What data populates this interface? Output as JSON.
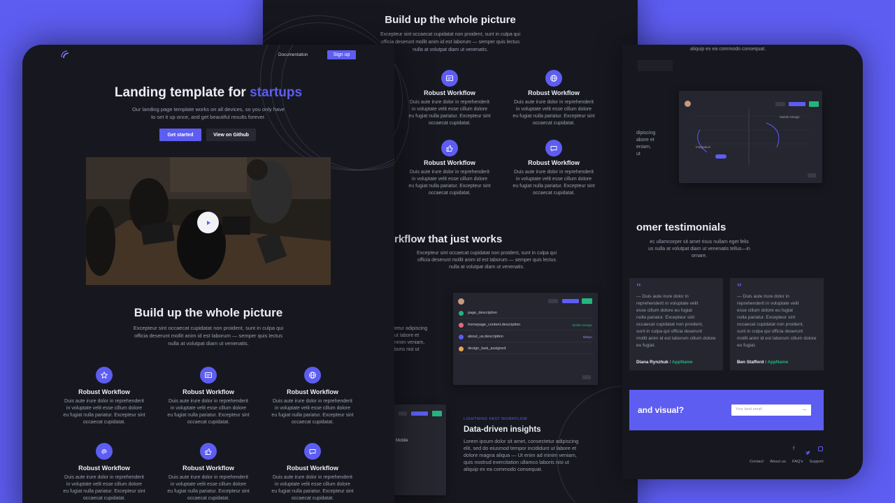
{
  "front": {
    "nav": {
      "documentation": "Documentation",
      "signup": "Sign up"
    },
    "hero": {
      "title_main": "Landing template for ",
      "title_accent": "startups",
      "subtitle_line1": "Our landing page template works on all devices, so you only have",
      "subtitle_line2": "to set it up once, and get beautiful results forever.",
      "get_started": "Get started",
      "github": "View on Github"
    },
    "section": {
      "title": "Build up the whole picture",
      "line1": "Excepteur sint occaecat cupidatat non proident, sunt in culpa qui",
      "line2": "officia deserunt mollit anim id est laborum — semper quis lectus",
      "line3": "nulla at volutpat diam ut venenatis."
    },
    "features": [
      {
        "icon": "star-icon",
        "title": "Robust Workflow"
      },
      {
        "icon": "browser-icon",
        "title": "Robust Workflow"
      },
      {
        "icon": "globe-icon",
        "title": "Robust Workflow"
      },
      {
        "icon": "fingerprint-icon",
        "title": "Robust Workflow"
      },
      {
        "icon": "thumbs-up-icon",
        "title": "Robust Workflow"
      },
      {
        "icon": "chat-icon",
        "title": "Robust Workflow"
      }
    ],
    "feature_text": {
      "l1": "Duis aute irure dolor in reprehenderit",
      "l2": "in voluptate velit esse cillum dolore",
      "l3": "eu fugiat nulla pariatur. Excepteur sint",
      "l4": "occaecat cupidatat."
    }
  },
  "back": {
    "section": {
      "title": "Build up the whole picture",
      "line1": "Excepteur sint occaecat cupidatat non proident, sunt in culpa qui",
      "line2": "officia deserunt mollit anim id est laborum — semper quis lectus",
      "line3": "nulla at volutpat diam ut venenatis."
    },
    "features": [
      {
        "icon": "browser-icon",
        "title": "Robust Workflow"
      },
      {
        "icon": "globe-icon",
        "title": "Robust Workflow"
      },
      {
        "icon": "thumbs-up-icon",
        "title": "Robust Workflow"
      },
      {
        "icon": "chat-icon",
        "title": "Robust Workflow"
      }
    ],
    "workflow": {
      "title": "rkflow that just works",
      "line1": "Excepteur sint occaecat cupidatat non proident, sunt in culpa qui",
      "line2": "officia deserunt mollit anim id est laborum — semper quis lectus",
      "line3": "nulla at volutpat diam ut venenatis.",
      "side_line1": "tetur adipiscing",
      "side_line2": "ut labore et",
      "side_line3": "ninim veniam,",
      "side_line4": "boris nisi ut"
    },
    "panel_rows": [
      {
        "label": "page_description",
        "tag": ""
      },
      {
        "label": "homepage_content.description",
        "tag": "Mobile Design"
      },
      {
        "label": "about_us.description",
        "tag": "Milepo"
      },
      {
        "label": "design_task_assigned",
        "tag": ""
      }
    ],
    "insights": {
      "eyebrow": "LIGHTNING FAST WORKFLOW",
      "title": "Data-driven insights",
      "line1": "Lorem ipsum dolor sit amet, consectetur adipiscing",
      "line2": "elit, sed do eiusmod tempor incididunt ut labore et",
      "line3": "dolore magna aliqua — Ut enim ad minim veniam,",
      "line4": "quis nostrud exercitation ullamco laboris nisi ut",
      "line5": "aliquip ex ea commodo consequat.",
      "mini_label": "Mobile"
    }
  },
  "right": {
    "top_text": "aliquip ex ea commodo consequat.",
    "side_text": {
      "l1": "dipiscing",
      "l2": "abore et",
      "l3": "eniam,",
      "l4": "ut"
    },
    "diagram": {
      "mobile_design": "Mobile Design",
      "integration": "Integration"
    },
    "testimonials": {
      "title": "omer testimonials",
      "line1": "ec ullamcorper sit amet risus nullam eget felis",
      "line2": "us nulla at volutpat diam ut venenatis tellus—in",
      "line3": "ornare.",
      "card1_author": "Diana Rynzhuk",
      "card2_author": "Ben Stafford",
      "separator": " / ",
      "company": "AppName"
    },
    "quote_text": {
      "l1": "— Duis aute irure dolor in",
      "l2": "reprehenderit in voluptate velit",
      "l3": "esse cillum dolore eu fugiat",
      "l4": "nulla pariatur. Excepteur sint",
      "l5": "occaecat cupidatat non proident,",
      "l6": "sunt in culpa qui officia deserunt",
      "l7": "mollit anim id est laborum cillum dolore",
      "l8": "eu fugiat."
    },
    "cta": {
      "title": "and visual?",
      "email_placeholder": "Your best email"
    },
    "footer_links": [
      "Contact",
      "About us",
      "FAQ's",
      "Support"
    ]
  },
  "colors": {
    "accent": "#5d5df2",
    "green": "#24b47e",
    "card": "#17181f",
    "panel": "#25262f"
  }
}
